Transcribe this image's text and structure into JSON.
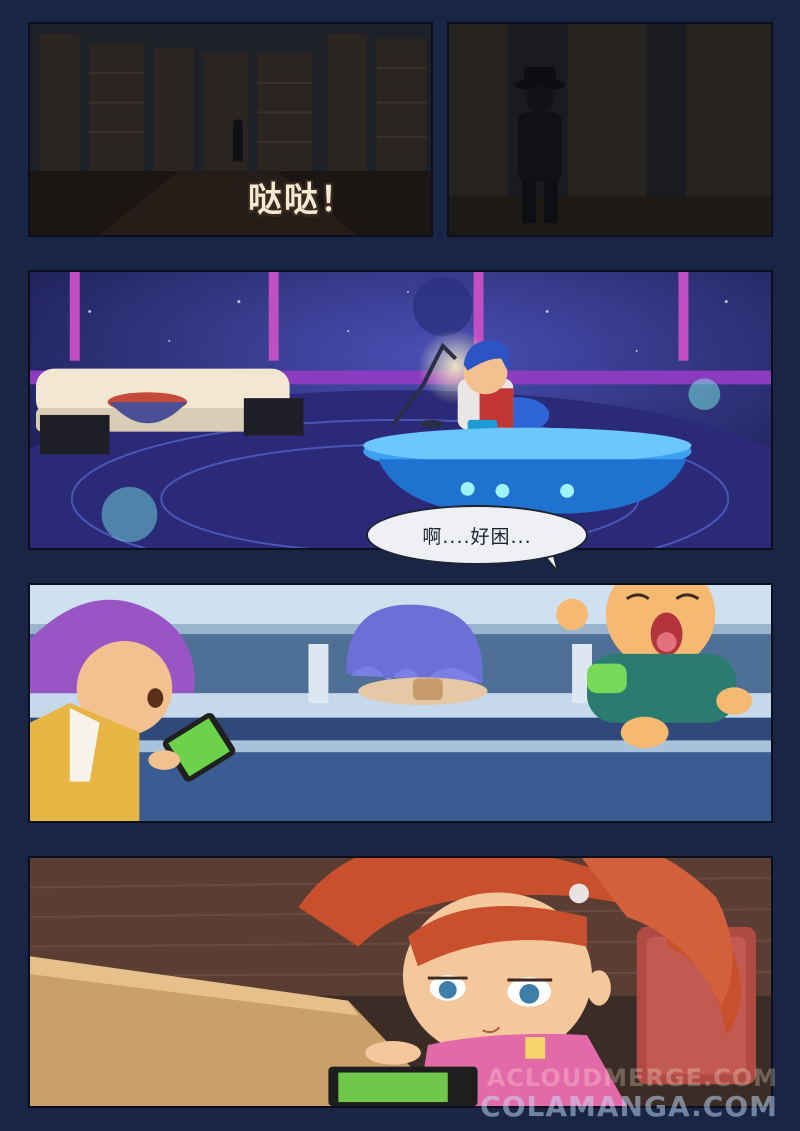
{
  "sound_effect": "哒哒！",
  "speech_bubble": "啊....好困...",
  "watermarks": {
    "line1": "ACLOUDMERGE.COM",
    "line2": "COLAMANGA.COM"
  },
  "colors": {
    "gutter": "#1a2445",
    "library_dark": "#1c1e26",
    "space_purple": "#2a2a78",
    "desk_blue": "#2f86e0",
    "hair_red": "#c8502c",
    "hair_purple": "#9a55c4",
    "tablet_green": "#6cd24a"
  }
}
